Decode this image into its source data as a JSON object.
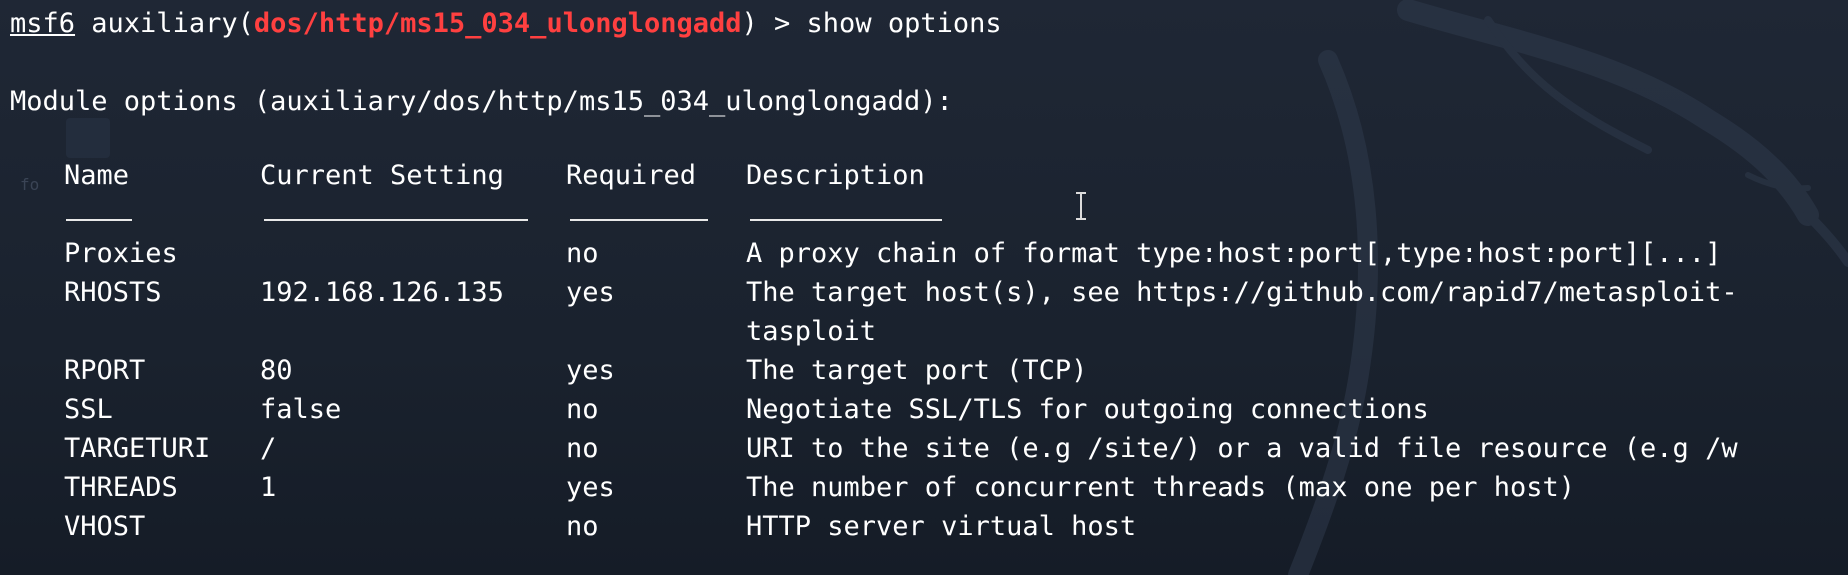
{
  "terminal": {
    "prompt": {
      "prefix": "msf6",
      "context_open": " auxiliary(",
      "module": "dos/http/ms15_034_ulonglongadd",
      "context_close": ") > ",
      "command": "show options"
    },
    "section_title": "Module options (auxiliary/dos/http/ms15_034_ulonglongadd):",
    "headers": {
      "name": "Name",
      "current_setting": "Current Setting",
      "required": "Required",
      "description": "Description"
    },
    "rows": [
      {
        "name": "Proxies",
        "setting": "",
        "required": "no",
        "description": "A proxy chain of format type:host:port[,type:host:port][...]"
      },
      {
        "name": "RHOSTS",
        "setting": "192.168.126.135",
        "required": "yes",
        "description": "The target host(s), see https://github.com/rapid7/metasploit-",
        "description_cont": "tasploit"
      },
      {
        "name": "RPORT",
        "setting": "80",
        "required": "yes",
        "description": "The target port (TCP)"
      },
      {
        "name": "SSL",
        "setting": "false",
        "required": "no",
        "description": "Negotiate SSL/TLS for outgoing connections"
      },
      {
        "name": "TARGETURI",
        "setting": "/",
        "required": "no",
        "description": "URI to the site (e.g /site/) or a valid file resource (e.g /w"
      },
      {
        "name": "THREADS",
        "setting": "1",
        "required": "yes",
        "description": "The number of concurrent threads (max one per host)"
      },
      {
        "name": "VHOST",
        "setting": "",
        "required": "no",
        "description": "HTTP server virtual host"
      }
    ]
  },
  "colors": {
    "background": "#1b2330",
    "text": "#ffffff",
    "module_highlight": "#ff4040"
  }
}
